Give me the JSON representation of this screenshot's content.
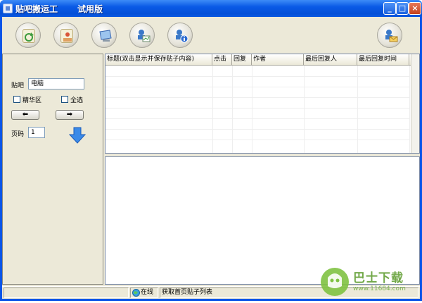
{
  "window": {
    "title": "贴吧搬运工",
    "edition": "试用版",
    "controls": {
      "minimize": "_",
      "maximize": "□",
      "close": "×"
    }
  },
  "toolbar": {
    "buttons": [
      {
        "name": "refresh-tool-button",
        "icon": "refresh-doc-icon",
        "color": "#4aa84a"
      },
      {
        "name": "stop-tool-button",
        "icon": "stop-doc-icon",
        "color": "#d9553a"
      },
      {
        "name": "monitor-tool-button",
        "icon": "monitor-icon",
        "color": "#3a78c8"
      },
      {
        "name": "presentation-tool-button",
        "icon": "presentation-user-icon",
        "color": "#3a88c8"
      },
      {
        "name": "info-tool-button",
        "icon": "info-user-icon",
        "color": "#2a6ad0"
      },
      {
        "name": "mail-tool-button",
        "icon": "mail-user-icon",
        "color": "#e0a030"
      }
    ]
  },
  "left_panel": {
    "tieba_label": "贴吧",
    "tieba_value": "电脑",
    "essence_label": "精华区",
    "select_all_label": "全选",
    "prev_arrow": "⬅",
    "next_arrow": "➡",
    "page_label": "页码",
    "page_value": "1"
  },
  "grid": {
    "columns": [
      "标题(双击显示并保存贴子内容)",
      "点击",
      "回复",
      "作者",
      "最后回复人",
      "最后回复时间"
    ]
  },
  "status": {
    "online": "在线",
    "message": "获取首页贴子列表"
  },
  "watermark": {
    "brand": "巴士下载",
    "url": "www.11684.com"
  }
}
